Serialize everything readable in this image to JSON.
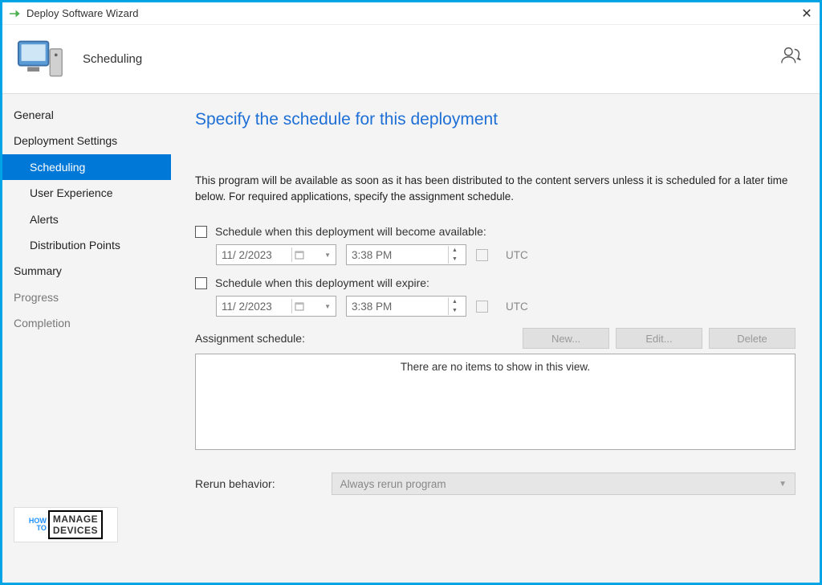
{
  "window": {
    "title": "Deploy Software Wizard"
  },
  "header": {
    "page": "Scheduling"
  },
  "sidebar": {
    "items": [
      {
        "label": "General"
      },
      {
        "label": "Deployment Settings"
      },
      {
        "label": "Scheduling"
      },
      {
        "label": "User Experience"
      },
      {
        "label": "Alerts"
      },
      {
        "label": "Distribution Points"
      },
      {
        "label": "Summary"
      },
      {
        "label": "Progress"
      },
      {
        "label": "Completion"
      }
    ]
  },
  "content": {
    "heading": "Specify the schedule for this deployment",
    "intro": "This program will be available as soon as it has been distributed to the content servers unless it is scheduled for a later time below. For required applications, specify the assignment schedule.",
    "available_label": "Schedule when this deployment will become available:",
    "expire_label": "Schedule when this deployment will expire:",
    "date1": "11/ 2/2023",
    "time1": "3:38 PM",
    "date2": "11/ 2/2023",
    "time2": "3:38 PM",
    "utc": "UTC",
    "assign_label": "Assignment schedule:",
    "btn_new": "New...",
    "btn_edit": "Edit...",
    "btn_delete": "Delete",
    "empty_text": "There are no items to show in this view.",
    "rerun_label": "Rerun behavior:",
    "rerun_value": "Always rerun program"
  },
  "watermark": {
    "how": "HOW",
    "to": "TO",
    "manage": "MANAGE",
    "devices": "DEVICES"
  }
}
